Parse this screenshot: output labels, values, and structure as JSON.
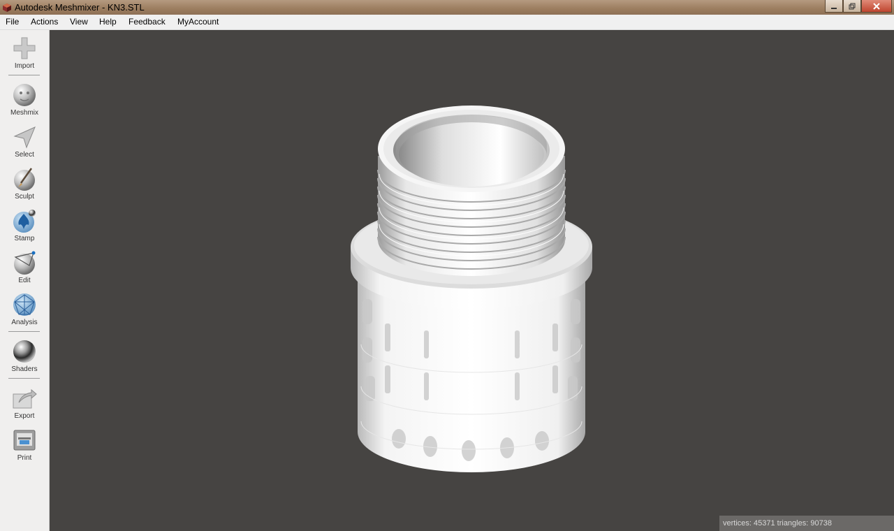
{
  "window": {
    "title": "Autodesk Meshmixer - KN3.STL"
  },
  "menu": [
    "File",
    "Actions",
    "View",
    "Help",
    "Feedback",
    "MyAccount"
  ],
  "tools": [
    {
      "label": "Import",
      "icon": "import-icon"
    },
    {
      "label": "Meshmix",
      "icon": "meshmix-icon"
    },
    {
      "label": "Select",
      "icon": "select-icon"
    },
    {
      "label": "Sculpt",
      "icon": "sculpt-icon"
    },
    {
      "label": "Stamp",
      "icon": "stamp-icon"
    },
    {
      "label": "Edit",
      "icon": "edit-icon"
    },
    {
      "label": "Analysis",
      "icon": "analysis-icon"
    },
    {
      "label": "Shaders",
      "icon": "shaders-icon"
    },
    {
      "label": "Export",
      "icon": "export-icon"
    },
    {
      "label": "Print",
      "icon": "print-icon"
    }
  ],
  "status": {
    "text": "vertices: 45371 triangles: 90738"
  },
  "colors": {
    "viewport_bg": "#464442",
    "mesh": "#ffffff",
    "toolbar_bg": "#f0efee"
  }
}
